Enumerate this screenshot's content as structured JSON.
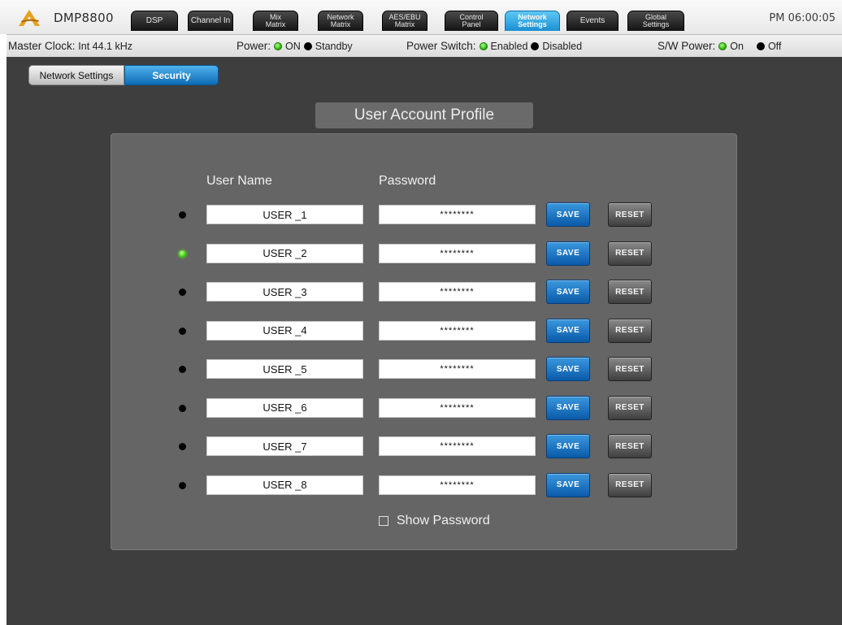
{
  "app": {
    "brand": "DMP8800",
    "clock": "PM 06:00:05"
  },
  "tabs": [
    {
      "label": "DSP",
      "active": false
    },
    {
      "label": "Channel In",
      "active": false
    },
    {
      "label": "Mix\nMatrix",
      "active": false
    },
    {
      "label": "Network\nMatrix",
      "active": false
    },
    {
      "label": "AES/EBU\nMatrix",
      "active": false
    },
    {
      "label": "Control\nPanel",
      "active": false
    },
    {
      "label": "Network\nSettings",
      "active": true
    },
    {
      "label": "Events",
      "active": false
    },
    {
      "label": "Global\nSettings",
      "active": false
    }
  ],
  "status": {
    "master_clock_label": "Master Clock:",
    "master_clock_value": "Int 44.1 kHz",
    "power_label": "Power:",
    "power_on": "ON",
    "power_standby": "Standby",
    "power_switch_label": "Power Switch:",
    "power_switch_enabled": "Enabled",
    "power_switch_disabled": "Disabled",
    "sw_power_label": "S/W Power:",
    "sw_power_on": "On",
    "sw_power_off": "Off",
    "colors": {
      "on": "#22b000",
      "off": "#000000"
    }
  },
  "subtabs": [
    {
      "label": "Network Settings",
      "active": false
    },
    {
      "label": "Security",
      "active": true
    }
  ],
  "profile": {
    "title": "User Account Profile",
    "col_username": "User Name",
    "col_password": "Password",
    "save_label": "SAVE",
    "reset_label": "RESET",
    "show_password_label": "Show Password",
    "show_password_checked": false,
    "users": [
      {
        "name": "USER _1",
        "password": "********",
        "active": false
      },
      {
        "name": "USER _2",
        "password": "********",
        "active": true
      },
      {
        "name": "USER _3",
        "password": "********",
        "active": false
      },
      {
        "name": "USER _4",
        "password": "********",
        "active": false
      },
      {
        "name": "USER _5",
        "password": "********",
        "active": false
      },
      {
        "name": "USER _6",
        "password": "********",
        "active": false
      },
      {
        "name": "USER _7",
        "password": "********",
        "active": false
      },
      {
        "name": "USER _8",
        "password": "********",
        "active": false
      }
    ]
  }
}
